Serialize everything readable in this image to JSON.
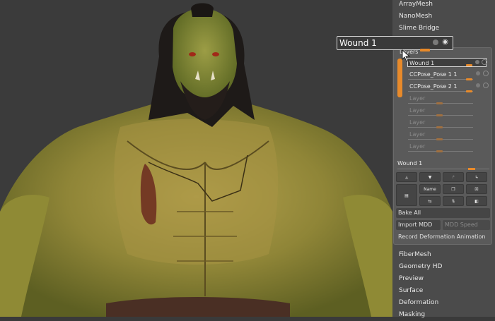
{
  "menu_top": [
    "ArrayMesh",
    "NanoMesh",
    "Slime Bridge"
  ],
  "tooltip": {
    "title": "Wound 1"
  },
  "layers": {
    "header": "Layers",
    "rows": [
      {
        "name": "Wound 1"
      },
      {
        "name": "CCPose_Pose 1 1"
      },
      {
        "name": "CCPose_Pose 2 1"
      },
      {
        "name": "Layer"
      },
      {
        "name": "Layer"
      },
      {
        "name": "Layer"
      },
      {
        "name": "Layer"
      },
      {
        "name": "Layer"
      }
    ],
    "selected_name": "Wound 1",
    "name_button": "Name",
    "bake_all": "Bake All",
    "import_mdd": "Import MDD",
    "mdd_speed": "MDD Speed",
    "record": "Record Deformation Animation"
  },
  "menu_bottom": [
    "FiberMesh",
    "Geometry HD",
    "Preview",
    "Surface",
    "Deformation",
    "Masking"
  ],
  "colors": {
    "accent": "#e88a2a",
    "panel": "#4b4b4b",
    "viewport": "#3b3b3b"
  }
}
